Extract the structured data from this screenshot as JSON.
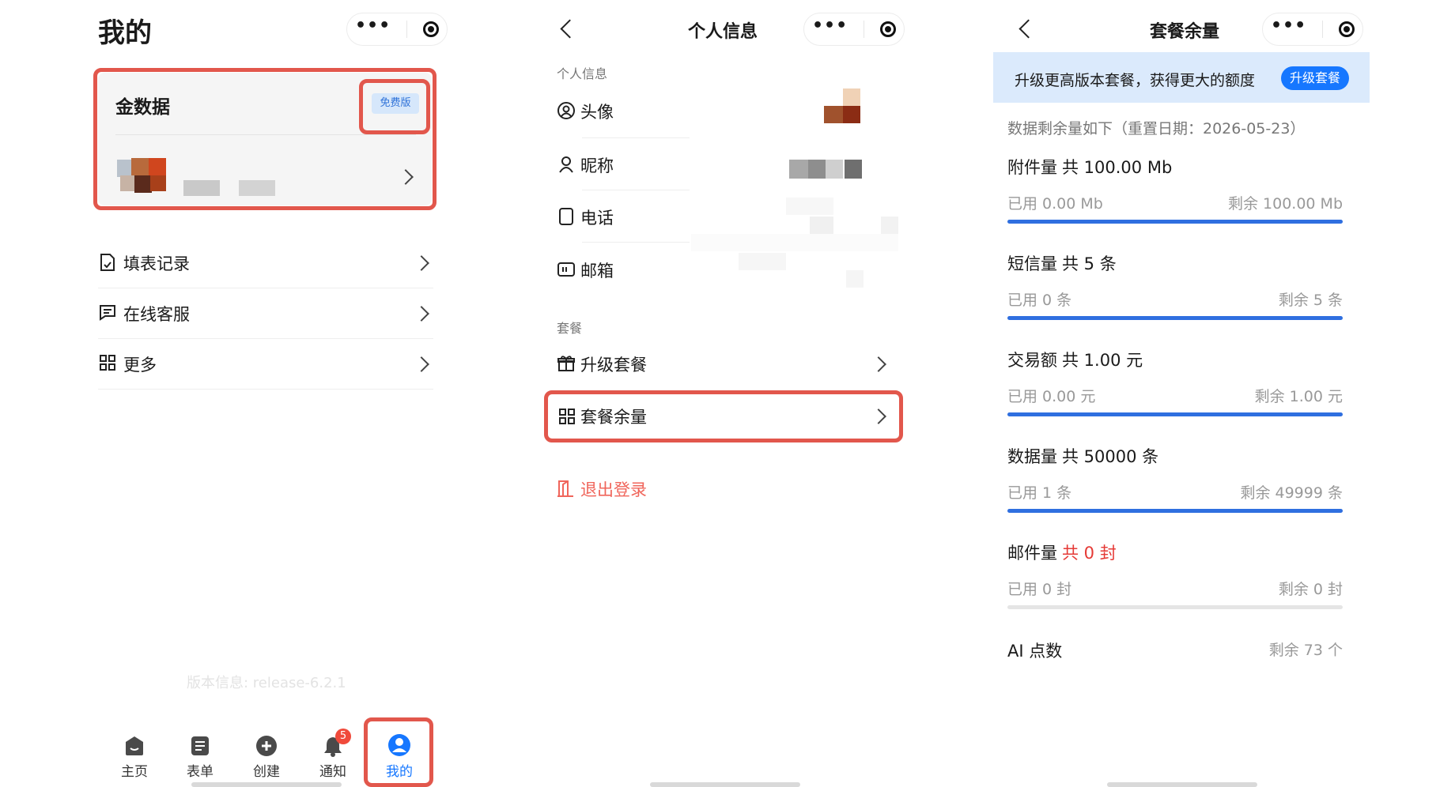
{
  "screen1": {
    "title": "我的",
    "card": {
      "company": "金数据",
      "badge": "免费版"
    },
    "menu": [
      {
        "label": "填表记录",
        "icon": "form-record-icon"
      },
      {
        "label": "在线客服",
        "icon": "chat-icon"
      },
      {
        "label": "更多",
        "icon": "grid-icon"
      }
    ],
    "version": "版本信息: release-6.2.1",
    "tabs": [
      {
        "label": "主页",
        "icon": "home-icon"
      },
      {
        "label": "表单",
        "icon": "form-icon"
      },
      {
        "label": "创建",
        "icon": "plus-icon"
      },
      {
        "label": "通知",
        "icon": "bell-icon",
        "badge": "5"
      },
      {
        "label": "我的",
        "icon": "user-icon",
        "active": true
      }
    ],
    "accent": "#1677ff"
  },
  "screen2": {
    "title": "个人信息",
    "section1": "个人信息",
    "rows": [
      {
        "label": "头像",
        "icon": "avatar-icon"
      },
      {
        "label": "昵称",
        "icon": "person-icon"
      },
      {
        "label": "电话",
        "icon": "phone-icon"
      },
      {
        "label": "邮箱",
        "icon": "mail-icon"
      }
    ],
    "section2": "套餐",
    "upgrade": "升级套餐",
    "quota": "套餐余量",
    "logout": "退出登录",
    "logout_color": "#f0655b"
  },
  "screen3": {
    "title": "套餐余量",
    "banner": {
      "text": "升级更高版本套餐，获得更大的额度",
      "button": "升级套餐"
    },
    "subtitle": "数据剩余量如下（重置日期：2026-05-23）",
    "items": [
      {
        "name": "附件量",
        "total": "共 100.00 Mb",
        "used": "已用 0.00 Mb",
        "remain": "剩余 100.00 Mb",
        "remain_fraction": 1.0
      },
      {
        "name": "短信量",
        "total": "共 5 条",
        "used": "已用 0 条",
        "remain": "剩余 5 条",
        "remain_fraction": 1.0
      },
      {
        "name": "交易额",
        "total": "共 1.00 元",
        "used": "已用 0.00 元",
        "remain": "剩余 1.00 元",
        "remain_fraction": 1.0
      },
      {
        "name": "数据量",
        "total": "共 50000 条",
        "used": "已用 1 条",
        "remain": "剩余 49999 条",
        "remain_fraction": 0.99998
      },
      {
        "name": "邮件量",
        "total": "共 0 封",
        "used": "已用 0 封",
        "remain": "剩余 0 封",
        "remain_fraction": 0.0,
        "total_color": "#e53935"
      }
    ],
    "ai": {
      "name": "AI 点数",
      "remain": "剩余 73 个"
    },
    "bar_color": "#2f6fe0"
  }
}
